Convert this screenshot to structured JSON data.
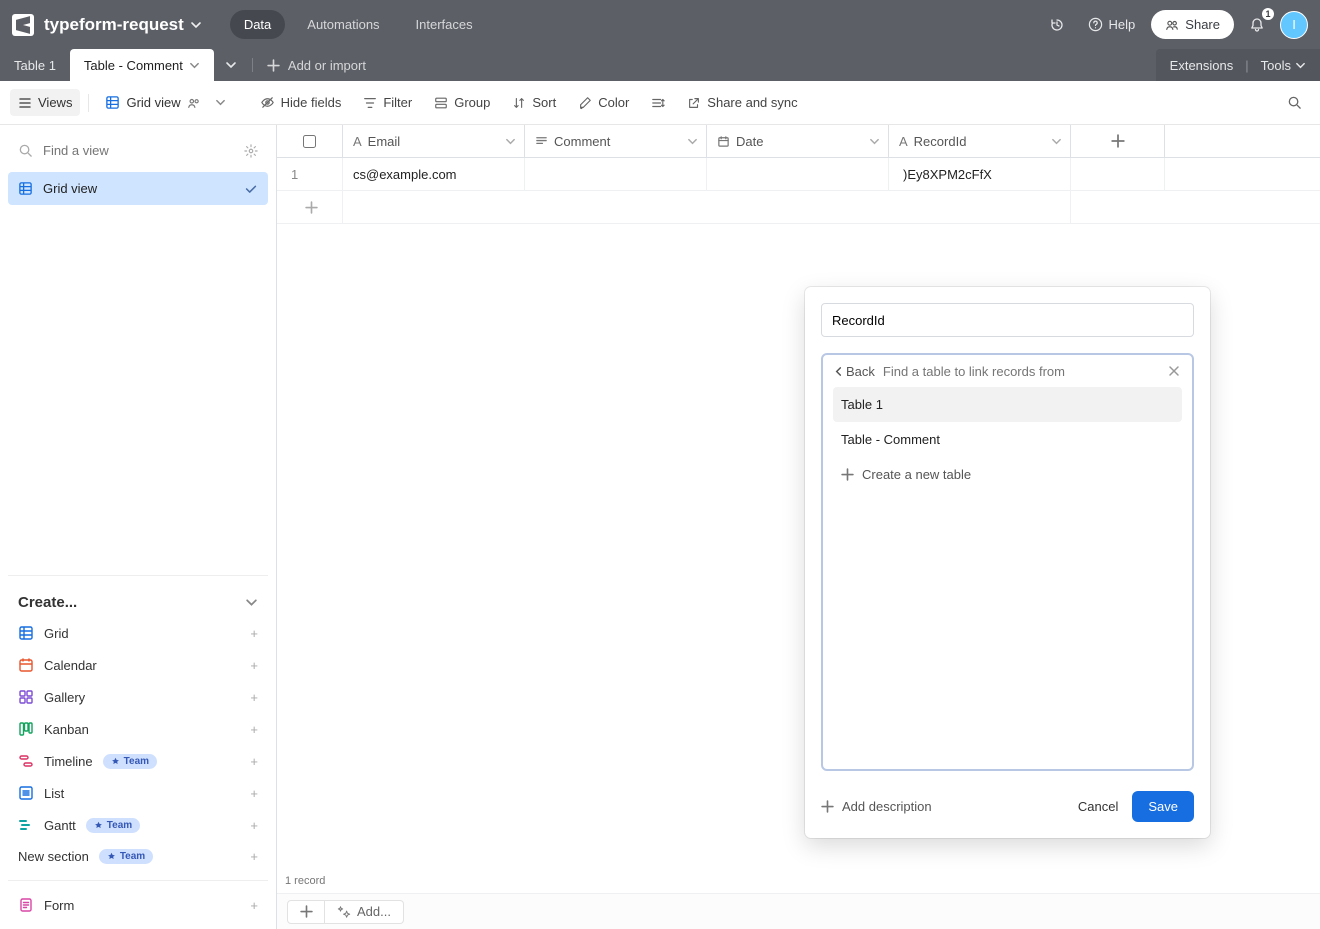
{
  "header": {
    "base_name": "typeform-request",
    "tabs": {
      "data": "Data",
      "automations": "Automations",
      "interfaces": "Interfaces"
    },
    "help": "Help",
    "share": "Share",
    "notification_count": "1",
    "avatar_initial": "I"
  },
  "tables": {
    "tab1": "Table 1",
    "tab2": "Table - Comment",
    "add_or_import": "Add or import",
    "extensions": "Extensions",
    "tools": "Tools"
  },
  "toolbar": {
    "views": "Views",
    "grid_view": "Grid view",
    "hide_fields": "Hide fields",
    "filter": "Filter",
    "group": "Group",
    "sort": "Sort",
    "color": "Color",
    "share_sync": "Share and sync"
  },
  "sidebar": {
    "search_placeholder": "Find a view",
    "view_active": "Grid view",
    "create": "Create...",
    "items": {
      "grid": "Grid",
      "calendar": "Calendar",
      "gallery": "Gallery",
      "kanban": "Kanban",
      "timeline": "Timeline",
      "list": "List",
      "gantt": "Gantt",
      "new_section": "New section",
      "form": "Form"
    },
    "team": "Team"
  },
  "grid": {
    "headers": {
      "email": "Email",
      "comment": "Comment",
      "date": "Date",
      "recordid": "RecordId"
    },
    "row1": {
      "num": "1",
      "email": "cs@example.com",
      "recordid": "  )Ey8XPM2cFfX"
    },
    "footer_add": "Add...",
    "record_count": "1 record"
  },
  "modal": {
    "field_name_value": "RecordId",
    "back": "Back",
    "search_placeholder": "Find a table to link records from",
    "options": {
      "t1": "Table 1",
      "t2": "Table - Comment"
    },
    "create_new_table": "Create a new table",
    "add_description": "Add description",
    "cancel": "Cancel",
    "save": "Save"
  }
}
